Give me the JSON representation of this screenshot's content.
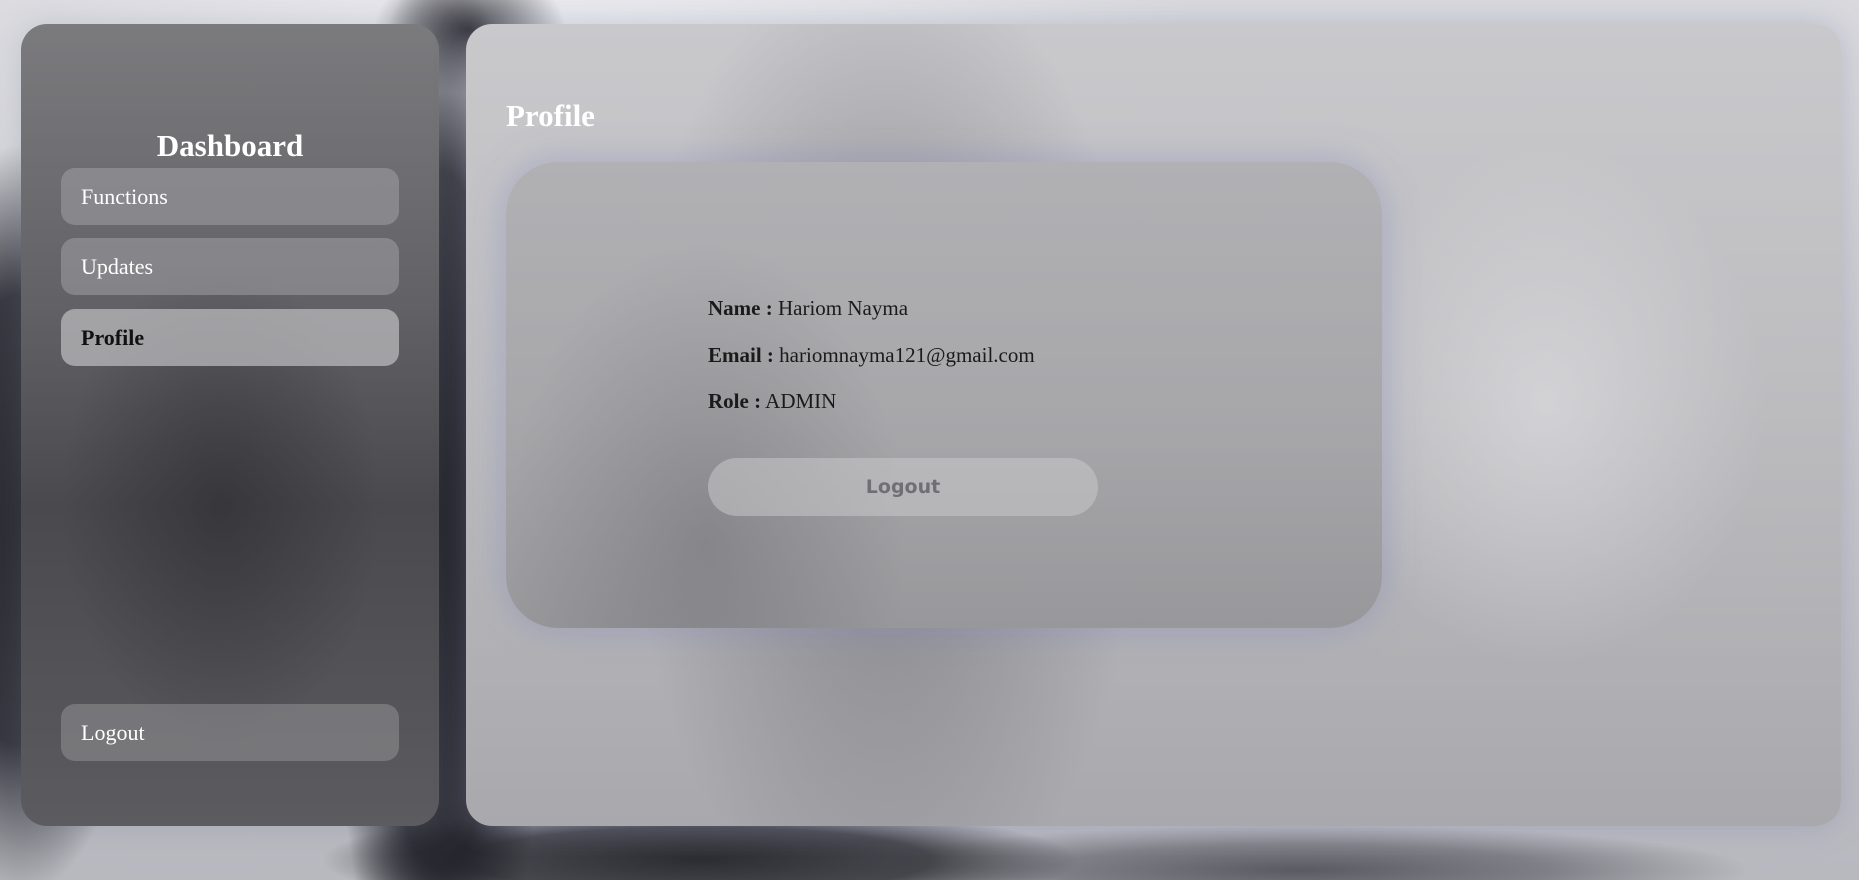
{
  "sidebar": {
    "title": "Dashboard",
    "items": [
      {
        "label": "Functions",
        "active": false
      },
      {
        "label": "Updates",
        "active": false
      },
      {
        "label": "Profile",
        "active": true
      }
    ],
    "logout_label": "Logout"
  },
  "main": {
    "title": "Profile",
    "profile": {
      "name_label": "Name :",
      "name_value": "Hariom Nayma",
      "email_label": "Email :",
      "email_value": "hariomnayma121@gmail.com",
      "role_label": "Role :",
      "role_value": "ADMIN",
      "logout_label": "Logout"
    }
  },
  "colors": {
    "sidebar_bg": "#5c5c60",
    "main_bg": "#c2c2c5",
    "card_bg": "#a7a7aa",
    "active_text": "#111111",
    "nav_text": "#ffffff"
  }
}
